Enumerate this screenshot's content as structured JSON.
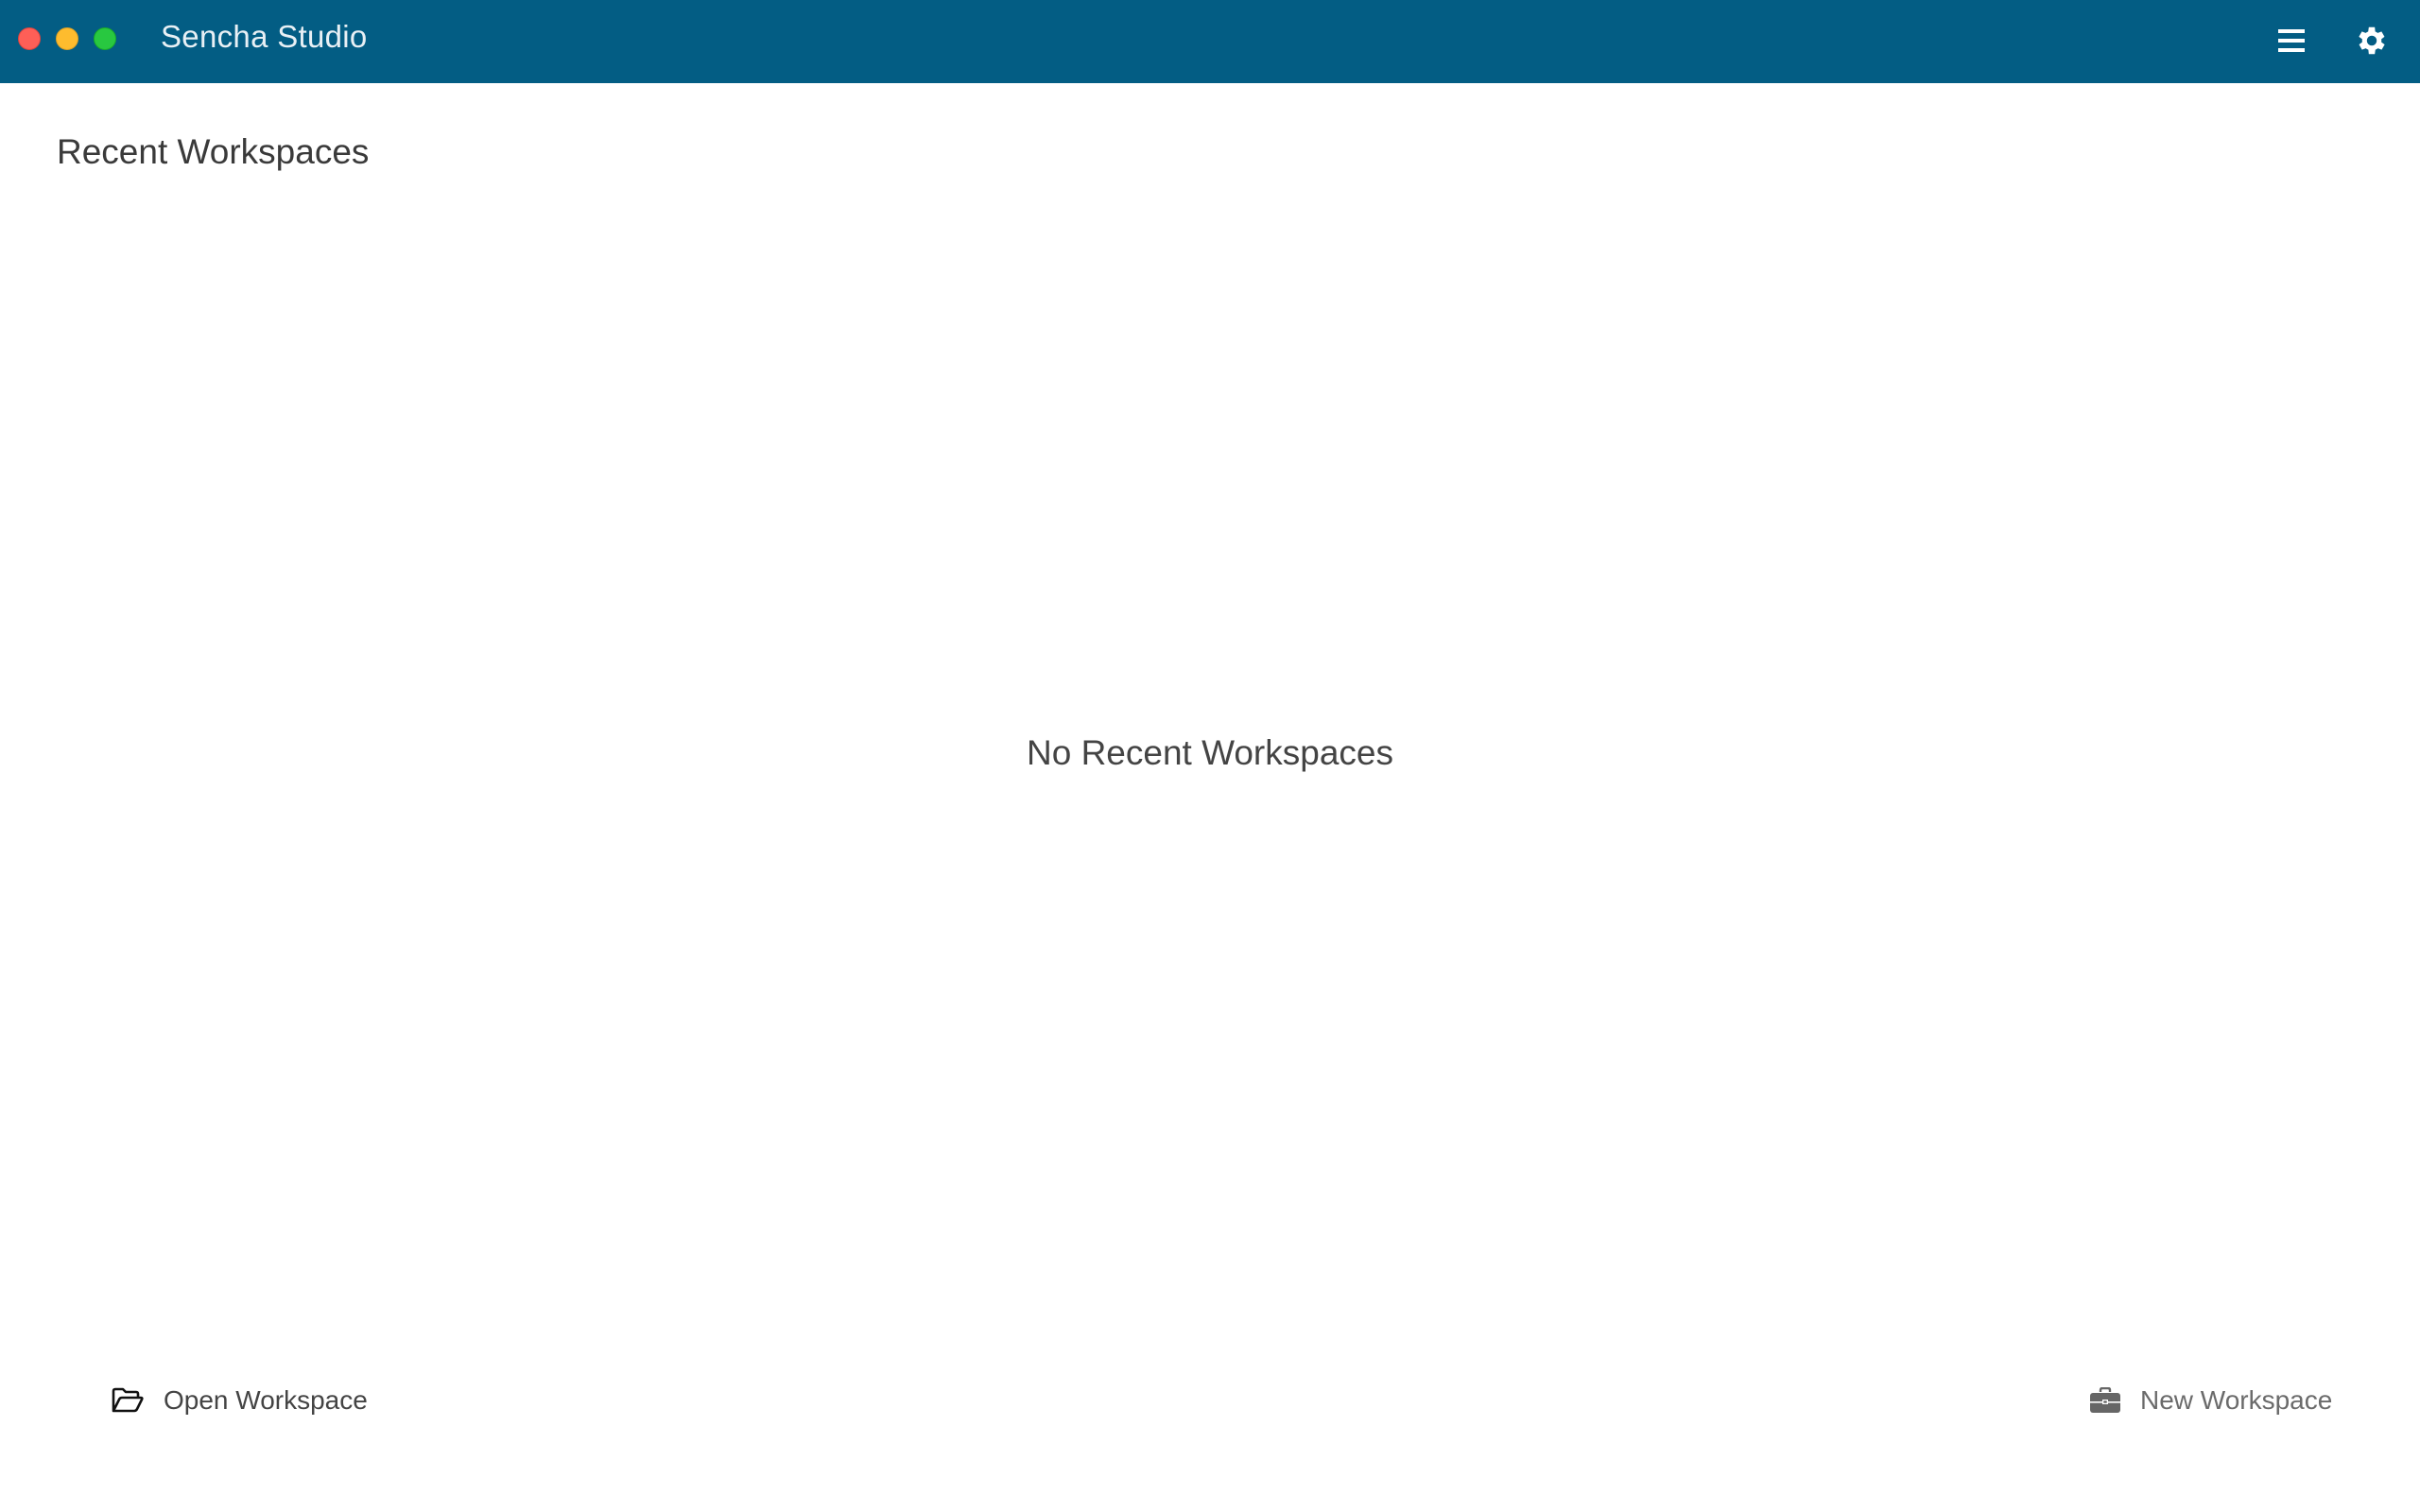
{
  "window": {
    "title": "Sencha Studio",
    "controls": [
      "close",
      "minimize",
      "maximize"
    ],
    "accent_color": "#035d84"
  },
  "header": {
    "menu_icon": "hamburger-menu-icon",
    "settings_icon": "gear-icon"
  },
  "main": {
    "heading": "Recent Workspaces",
    "empty_message": "No Recent Workspaces"
  },
  "footer": {
    "open_workspace": {
      "label": "Open Workspace",
      "icon": "folder-open-icon"
    },
    "new_workspace": {
      "label": "New Workspace",
      "icon": "briefcase-icon"
    }
  }
}
